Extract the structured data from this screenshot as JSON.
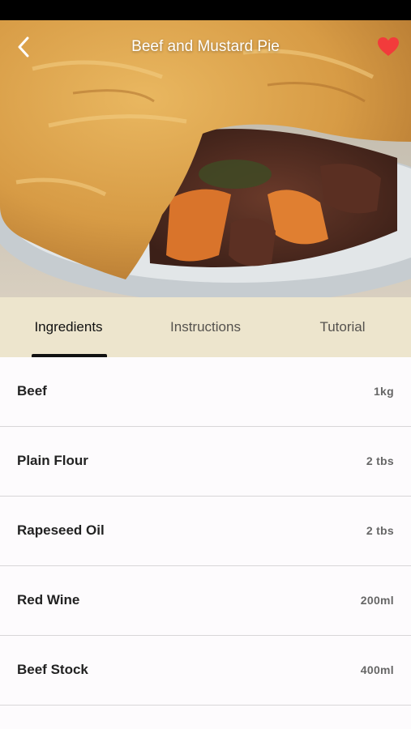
{
  "header": {
    "title": "Beef and Mustard Pie"
  },
  "icons": {
    "back": "chevron-left-icon",
    "favorite": "heart-icon"
  },
  "colors": {
    "favorite": "#f23b3b",
    "tab_bar": "#ede5cd",
    "indicator": "#111111"
  },
  "tabs": [
    {
      "label": "Ingredients",
      "active": true
    },
    {
      "label": "Instructions",
      "active": false
    },
    {
      "label": "Tutorial",
      "active": false
    }
  ],
  "ingredients": [
    {
      "name": "Beef",
      "quantity": "1kg"
    },
    {
      "name": "Plain Flour",
      "quantity": "2 tbs"
    },
    {
      "name": "Rapeseed Oil",
      "quantity": "2 tbs"
    },
    {
      "name": "Red Wine",
      "quantity": "200ml"
    },
    {
      "name": "Beef Stock",
      "quantity": "400ml"
    }
  ]
}
